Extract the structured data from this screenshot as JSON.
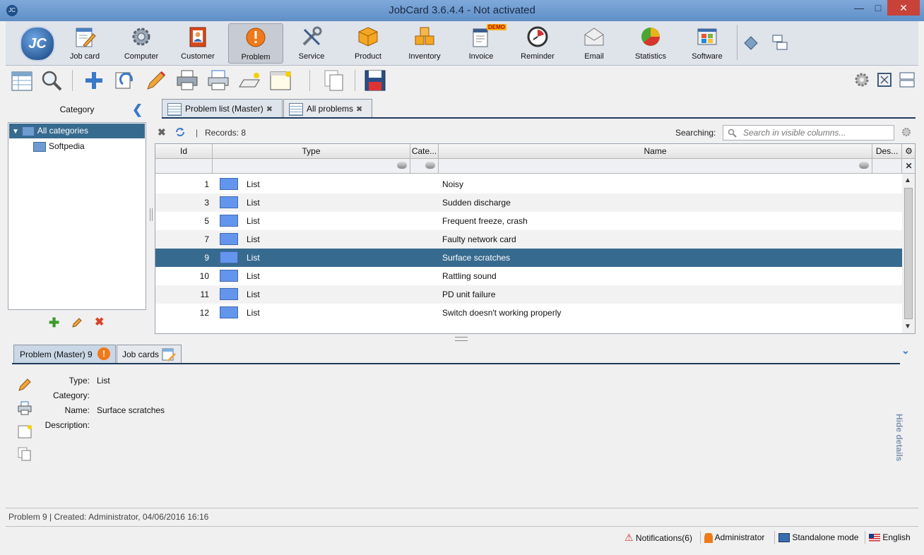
{
  "window": {
    "title": "JobCard 3.6.4.4 - Not activated",
    "logo_text": "JC",
    "app_icon_text": "JC"
  },
  "modules": [
    {
      "label": "Job card",
      "icon": "job-card-icon"
    },
    {
      "label": "Computer",
      "icon": "computer-gear-icon"
    },
    {
      "label": "Customer",
      "icon": "customer-icon"
    },
    {
      "label": "Problem",
      "icon": "problem-icon",
      "active": true
    },
    {
      "label": "Service",
      "icon": "service-tools-icon"
    },
    {
      "label": "Product",
      "icon": "product-box-icon"
    },
    {
      "label": "Inventory",
      "icon": "inventory-boxes-icon"
    },
    {
      "label": "Invoice",
      "icon": "invoice-icon",
      "badge": "DEMO"
    },
    {
      "label": "Reminder",
      "icon": "reminder-clock-icon"
    },
    {
      "label": "Email",
      "icon": "email-icon"
    },
    {
      "label": "Statistics",
      "icon": "statistics-pie-icon"
    },
    {
      "label": "Software",
      "icon": "software-icon"
    }
  ],
  "category_panel": {
    "title": "Category",
    "items": [
      "All categories",
      "Softpedia"
    ]
  },
  "tabs": [
    {
      "label": "Problem list (Master)"
    },
    {
      "label": "All problems"
    }
  ],
  "grid": {
    "records_label": "Records: 8",
    "searching_label": "Searching:",
    "search_placeholder": "Search in visible columns...",
    "columns": [
      "Id",
      "Type",
      "Cate...",
      "Name",
      "Des..."
    ],
    "rows": [
      {
        "id": "1",
        "type": "List",
        "name": "Noisy"
      },
      {
        "id": "3",
        "type": "List",
        "name": "Sudden discharge"
      },
      {
        "id": "5",
        "type": "List",
        "name": "Frequent freeze, crash"
      },
      {
        "id": "7",
        "type": "List",
        "name": "Faulty network card"
      },
      {
        "id": "9",
        "type": "List",
        "name": "Surface scratches",
        "selected": true
      },
      {
        "id": "10",
        "type": "List",
        "name": "Rattling sound"
      },
      {
        "id": "11",
        "type": "List",
        "name": "PD unit failure"
      },
      {
        "id": "12",
        "type": "List",
        "name": "Switch doesn't working properly"
      }
    ],
    "swatch_color": "#6495ed",
    "selected_color": "#376a8f"
  },
  "details": {
    "tabs": [
      "Problem (Master) 9",
      "Job cards"
    ],
    "fields": [
      {
        "label": "Type:",
        "value": "List"
      },
      {
        "label": "Category:",
        "value": ""
      },
      {
        "label": "Name:",
        "value": "Surface scratches"
      },
      {
        "label": "Description:",
        "value": ""
      }
    ],
    "hide_label": "Hide details"
  },
  "status": {
    "line": "Problem 9 | Created: Administrator, 04/06/2016 16:16",
    "notifications": "Notifications(6)",
    "user": "Administrator",
    "mode": "Standalone mode",
    "language": "English"
  }
}
